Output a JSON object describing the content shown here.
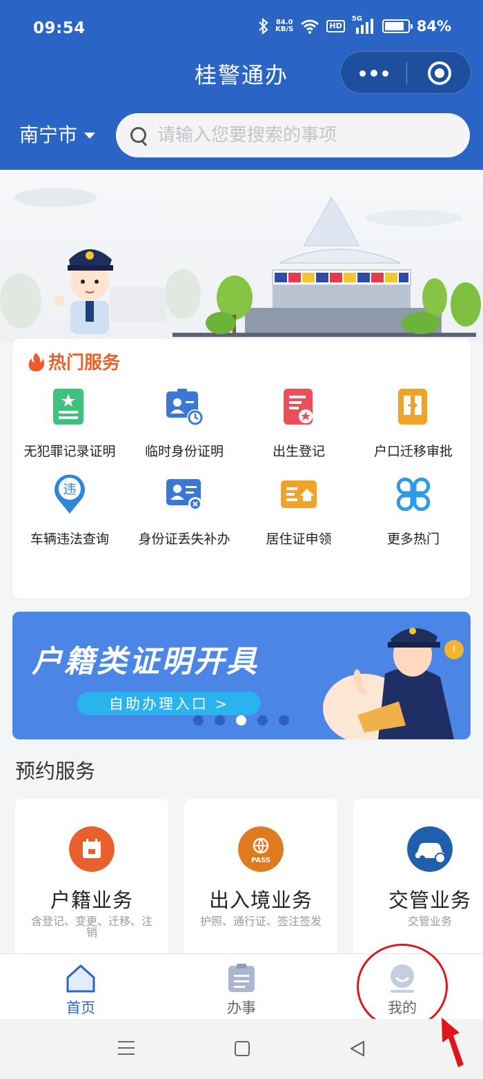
{
  "status_bar": {
    "time": "09:54",
    "net_speed_value": "84.0",
    "net_speed_unit": "KB/S",
    "hd": "HD",
    "network": "5G",
    "battery_text": "84%",
    "battery_level": 0.84
  },
  "header": {
    "title": "桂警通办",
    "city": "南宁市",
    "search_placeholder": "请输入您要搜索的事项"
  },
  "hot_services": {
    "title": "热门服务",
    "items": [
      {
        "label": "无犯罪记录证明",
        "icon": "certificate-star-icon",
        "color": "#3ec37d"
      },
      {
        "label": "临时身份证明",
        "icon": "temp-id-card-icon",
        "color": "#3a78d6"
      },
      {
        "label": "出生登记",
        "icon": "birth-register-icon",
        "color": "#ec4f5a"
      },
      {
        "label": "户口迁移审批",
        "icon": "household-transfer-icon",
        "color": "#f0a32b"
      },
      {
        "label": "车辆违法查询",
        "icon": "violation-location-icon",
        "color": "#2e86de"
      },
      {
        "label": "身份证丢失补办",
        "icon": "id-card-reissue-icon",
        "color": "#3a78d6"
      },
      {
        "label": "居住证申领",
        "icon": "residence-permit-icon",
        "color": "#f0a32b"
      },
      {
        "label": "更多热门",
        "icon": "more-grid-icon",
        "color": "#2e9ae8"
      }
    ]
  },
  "promo_banner": {
    "title": "户籍类证明开具",
    "button": "自助办理入口 >",
    "slide_count": 5,
    "active_slide": 3
  },
  "appointment": {
    "title": "预约服务",
    "cards": [
      {
        "name": "户籍业务",
        "desc": "含登记、变更、迁移、注销",
        "icon": "household-calendar-icon",
        "color": "#e8612c"
      },
      {
        "name": "出入境业务",
        "desc": "护照、通行证、签注签发",
        "icon": "passport-icon",
        "color": "#e07a1f"
      },
      {
        "name": "交管业务",
        "desc": "交管业务",
        "icon": "car-icon",
        "color": "#1f5fad"
      }
    ]
  },
  "tab_bar": {
    "tabs": [
      {
        "label": "首页",
        "icon": "home-icon",
        "active": true
      },
      {
        "label": "办事",
        "icon": "clipboard-icon",
        "active": false
      },
      {
        "label": "我的",
        "icon": "user-icon",
        "active": false
      }
    ]
  },
  "colors": {
    "header_bg": "#2a65c6",
    "accent_orange": "#e8612c",
    "annotation_red": "#e0141c"
  }
}
